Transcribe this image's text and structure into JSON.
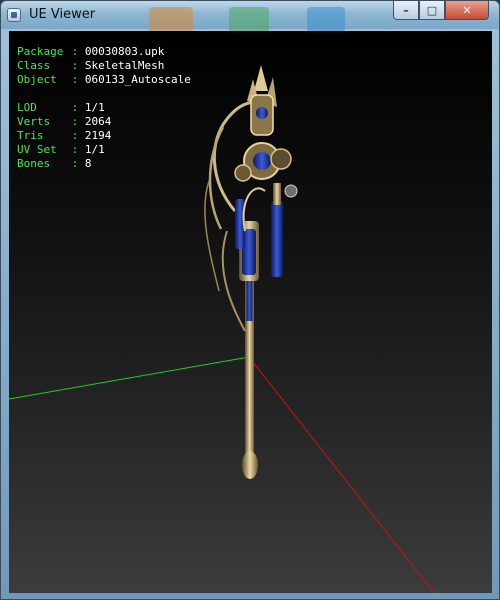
{
  "window": {
    "title": "UE Viewer",
    "controls": {
      "minimize": "–",
      "maximize": "□",
      "close": "✕"
    }
  },
  "info": {
    "package": {
      "label": "Package",
      "value": "00030803.upk"
    },
    "class": {
      "label": "Class",
      "value": "SkeletalMesh"
    },
    "object": {
      "label": "Object",
      "value": "060133_Autoscale"
    },
    "lod": {
      "label": "LOD",
      "value": "1/1"
    },
    "verts": {
      "label": "Verts",
      "value": "2064"
    },
    "tris": {
      "label": "Tris",
      "value": "2194"
    },
    "uvset": {
      "label": "UV Set",
      "value": "1/1"
    },
    "bones": {
      "label": "Bones",
      "value": "8"
    }
  },
  "colors": {
    "label_text": "#50e250",
    "value_text": "#ffffff",
    "axis_x": "#cc1111",
    "axis_y": "#22cc22",
    "viewport_top": "#000000",
    "viewport_bottom": "#3c3c3c"
  }
}
